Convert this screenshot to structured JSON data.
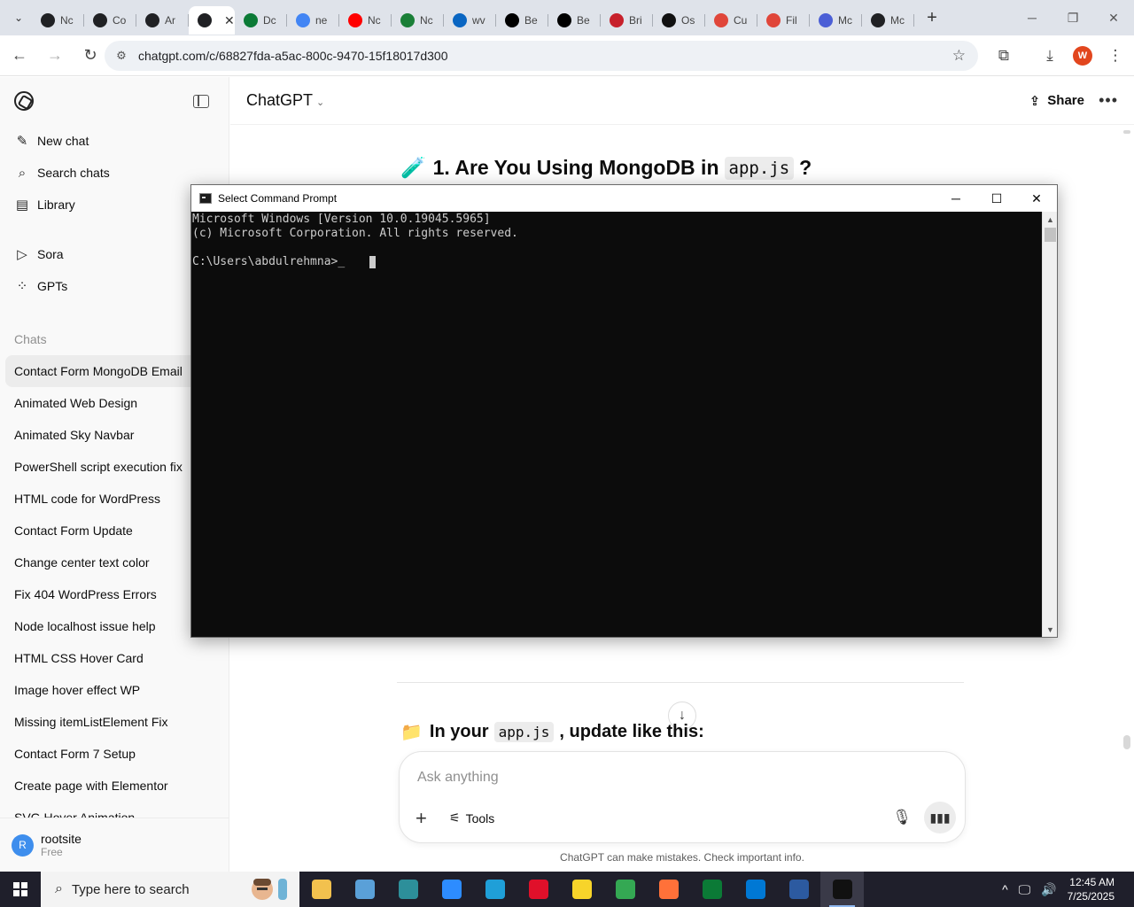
{
  "browser": {
    "tabs": [
      {
        "label": "Nc",
        "icon": "mongodb-leaf-icon",
        "color": "#202124"
      },
      {
        "label": "Co",
        "icon": "chatgpt-icon",
        "color": "#202124"
      },
      {
        "label": "Ar",
        "icon": "chatgpt-icon",
        "color": "#202124"
      },
      {
        "label": "",
        "icon": "chatgpt-icon",
        "color": "#202124",
        "active": true
      },
      {
        "label": "Dc",
        "icon": "mongodb-leaf-icon",
        "color": "#0b7a36"
      },
      {
        "label": "ne",
        "icon": "google-icon",
        "color": "#4285f4"
      },
      {
        "label": "Nc",
        "icon": "youtube-icon",
        "color": "#ff0000"
      },
      {
        "label": "Nc",
        "icon": "w-icon",
        "color": "#1a7f37"
      },
      {
        "label": "wv",
        "icon": "linkedin-icon",
        "color": "#0a66c2"
      },
      {
        "label": "Be",
        "icon": "x-icon",
        "color": "#000000"
      },
      {
        "label": "Be",
        "icon": "x-icon",
        "color": "#000000"
      },
      {
        "label": "Bri",
        "icon": "pdf-icon",
        "color": "#c7202b"
      },
      {
        "label": "Os",
        "icon": "sparkle-icon",
        "color": "#111111"
      },
      {
        "label": "Cu",
        "icon": "diamond-icon",
        "color": "#e0463a"
      },
      {
        "label": "Fil",
        "icon": "diamond-icon",
        "color": "#e0463a"
      },
      {
        "label": "Mc",
        "icon": "m-icon",
        "color": "#4b5fd6"
      },
      {
        "label": "Mc",
        "icon": "mongodb-leaf-icon",
        "color": "#202124"
      }
    ],
    "url": "chatgpt.com/c/68827fda-a5ac-800c-9470-15f18017d300",
    "profile_initial": "W"
  },
  "sidebar": {
    "top_items": [
      {
        "label": "New chat",
        "icon": "pencil-square-icon"
      },
      {
        "label": "Search chats",
        "icon": "search-icon"
      },
      {
        "label": "Library",
        "icon": "library-icon"
      }
    ],
    "mid_items": [
      {
        "label": "Sora",
        "icon": "play-circle-icon"
      },
      {
        "label": "GPTs",
        "icon": "grid-icon"
      }
    ],
    "chats_heading": "Chats",
    "chats": [
      "Contact Form MongoDB Email",
      "Animated Web Design",
      "Animated Sky Navbar",
      "PowerShell script execution fix",
      "HTML code for WordPress",
      "Contact Form Update",
      "Change center text color",
      "Fix 404 WordPress Errors",
      "Node localhost issue help",
      "HTML CSS Hover Card",
      "Image hover effect WP",
      "Missing itemListElement Fix",
      "Contact Form 7 Setup",
      "Create page with Elementor",
      "SVG Hover Animation"
    ],
    "user": {
      "initial": "R",
      "name": "rootsite",
      "plan": "Free"
    }
  },
  "main": {
    "model": "ChatGPT",
    "share_label": "Share",
    "heading1": {
      "emoji": "🧪",
      "prefix": "1. Are You Using MongoDB in",
      "code": "app.js",
      "suffix": "?"
    },
    "heading2": {
      "emoji": "📁",
      "prefix": "In your",
      "code": "app.js",
      "suffix": ", update like this:"
    },
    "composer": {
      "placeholder": "Ask anything",
      "tools_label": "Tools"
    },
    "disclaimer": "ChatGPT can make mistakes. Check important info."
  },
  "cmd": {
    "title": "Select Command Prompt",
    "lines": [
      "Microsoft Windows [Version 10.0.19045.5965]",
      "(c) Microsoft Corporation. All rights reserved.",
      "",
      "C:\\Users\\abdulrehmna>_"
    ]
  },
  "taskbar": {
    "search_placeholder": "Type here to search",
    "time": "12:45 AM",
    "date": "7/25/2025",
    "apps": [
      {
        "name": "file-explorer",
        "color": "#f2c14e"
      },
      {
        "name": "paint-app",
        "color": "#5aa0d8"
      },
      {
        "name": "app-diamond",
        "color": "#2d8f9a"
      },
      {
        "name": "zoom",
        "color": "#2d8cff"
      },
      {
        "name": "edge",
        "color": "#1f9fd8"
      },
      {
        "name": "opera",
        "color": "#e0102a"
      },
      {
        "name": "sticky-notes",
        "color": "#f7d42a"
      },
      {
        "name": "chrome",
        "color": "#34a853"
      },
      {
        "name": "firefox",
        "color": "#ff7139"
      },
      {
        "name": "mongodb-compass",
        "color": "#0b7a36"
      },
      {
        "name": "vscode",
        "color": "#0078d4"
      },
      {
        "name": "powershell",
        "color": "#2c5aa0"
      },
      {
        "name": "command-prompt",
        "color": "#111111",
        "active": true
      }
    ]
  }
}
